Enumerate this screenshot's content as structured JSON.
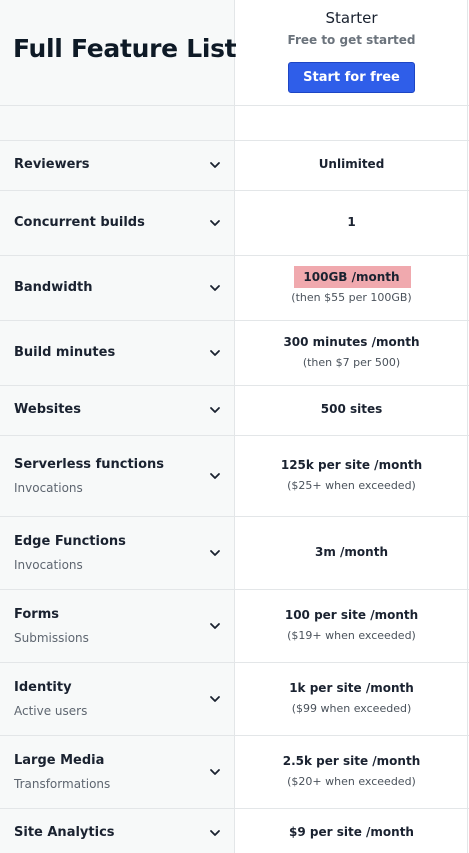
{
  "header": {
    "title": "Full Feature List",
    "plan_name": "Starter",
    "plan_subtitle": "Free to get started",
    "cta_label": "Start for free",
    "accent_color": "#2f5ee9"
  },
  "features": [
    {
      "label": "Reviewers",
      "sub": "",
      "value": "Unlimited",
      "value_note": ""
    },
    {
      "label": "Concurrent builds",
      "sub": "",
      "value": "1",
      "value_note": ""
    },
    {
      "label": "Bandwidth",
      "sub": "",
      "value": "100GB /month",
      "value_note": "(then $55 per 100GB)",
      "highlight": true
    },
    {
      "label": "Build minutes",
      "sub": "",
      "value": "300 minutes /month",
      "value_note": "(then $7 per 500)"
    },
    {
      "label": "Websites",
      "sub": "",
      "value": "500 sites",
      "value_note": ""
    },
    {
      "label": "Serverless functions",
      "sub": "Invocations",
      "value": "125k per site /month",
      "value_note": "($25+ when exceeded)"
    },
    {
      "label": "Edge Functions",
      "sub": "Invocations",
      "value": "3m /month",
      "value_note": ""
    },
    {
      "label": "Forms",
      "sub": "Submissions",
      "value": "100 per site /month",
      "value_note": "($19+ when exceeded)"
    },
    {
      "label": "Identity",
      "sub": "Active users",
      "value": "1k per site /month",
      "value_note": "($99 when exceeded)"
    },
    {
      "label": "Large Media",
      "sub": "Transformations",
      "value": "2.5k per site /month",
      "value_note": "($20+ when exceeded)"
    },
    {
      "label": "Site Analytics",
      "sub": "",
      "value": "$9 per site /month",
      "value_note": ""
    }
  ],
  "icons": {
    "expand": "chevron-down-icon"
  }
}
